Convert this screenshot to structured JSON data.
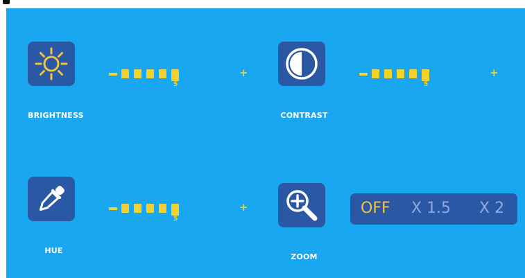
{
  "colors": {
    "panel_bg": "#19a7f1",
    "tile_bg": "#2b58a5",
    "accent_yellow": "#f3d230",
    "zoom_inactive": "#8fa8e0",
    "zoom_active": "#f3c33a"
  },
  "controls": {
    "brightness": {
      "label": "BRIGHTNESS",
      "icon": "sun-icon",
      "level": "5",
      "segments": 5,
      "minus": "−",
      "plus": "+"
    },
    "contrast": {
      "label": "CONTRAST",
      "icon": "contrast-icon",
      "level": "5",
      "segments": 5,
      "minus": "−",
      "plus": "+"
    },
    "hue": {
      "label": "HUE",
      "icon": "eyedropper-icon",
      "level": "5",
      "segments": 5,
      "minus": "−",
      "plus": "+"
    },
    "zoom": {
      "label": "ZOOM",
      "icon": "zoom-in-icon",
      "options": [
        "OFF",
        "X 1.5",
        "X 2"
      ],
      "selected": "OFF"
    }
  }
}
